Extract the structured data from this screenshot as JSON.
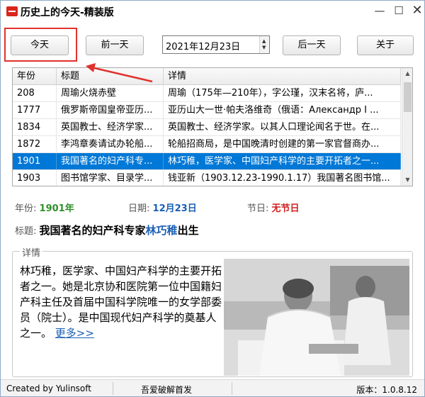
{
  "window": {
    "title": "历史上的今天-精装版",
    "minimize": "—",
    "maximize": "☐",
    "close": "✕"
  },
  "toolbar": {
    "today_label": "今天",
    "prev_label": "前一天",
    "next_label": "后一天",
    "about_label": "关于",
    "date_value": "2021年12月23日"
  },
  "grid": {
    "columns": [
      "年份",
      "标题",
      "详情"
    ],
    "rows": [
      {
        "year": "208",
        "title": "周瑜火烧赤壁",
        "detail": "周瑜（175年—210年），字公瑾，汉末名将，庐..."
      },
      {
        "year": "1777",
        "title": "俄罗斯帝国皇帝亚历...",
        "detail": "亚历山大一世·帕夫洛维奇（俄语：Александр I ..."
      },
      {
        "year": "1834",
        "title": "英国教士、经济学家...",
        "detail": "英国教士、经济学家。以其人口理论闻名于世。在..."
      },
      {
        "year": "1872",
        "title": "李鸿章奏请试办轮船...",
        "detail": "轮船招商局，是中国晚清时创建的第一家官督商办..."
      },
      {
        "year": "1901",
        "title": "我国著名的妇产科专...",
        "detail": "林巧稚，医学家、中国妇产科学的主要开拓者之一..."
      },
      {
        "year": "1903",
        "title": "图书馆学家、目录学...",
        "detail": "钱亚新（1903.12.23-1990.1.17）我国著名图书馆..."
      }
    ],
    "selected_index": 4
  },
  "info": {
    "year_label": "年份:",
    "year_value": "1901年",
    "date_label": "日期:",
    "date_value": "12月23日",
    "holiday_label": "节日:",
    "holiday_value": "无节日",
    "title_label": "标题:",
    "title_prefix": "我国著名的妇产科专家",
    "title_name": "林巧稚",
    "title_suffix": "出生"
  },
  "details": {
    "legend": "详情",
    "text": "林巧稚，医学家、中国妇产科学的主要开拓者之一。她是北京协和医院第一位中国籍妇产科主任及首届中国科学院唯一的女学部委员（院士）。是中国现代妇产科学的奠基人之一。",
    "more_label": "更多>>"
  },
  "status": {
    "left": "Created by Yulinsoft",
    "middle": "吾爱破解首发",
    "right": "版本：1.0.8.12"
  },
  "colors": {
    "selection": "#0078d7",
    "highlight_frame": "#e0322e",
    "accent_blue": "#1a5fb4",
    "accent_green": "#2f8f2a",
    "accent_red": "#d11f1f"
  },
  "icons": [
    "app-icon",
    "minimize-icon",
    "maximize-icon",
    "close-icon",
    "spin-up-icon",
    "spin-down-icon",
    "scroll-up-icon",
    "scroll-down-icon"
  ]
}
